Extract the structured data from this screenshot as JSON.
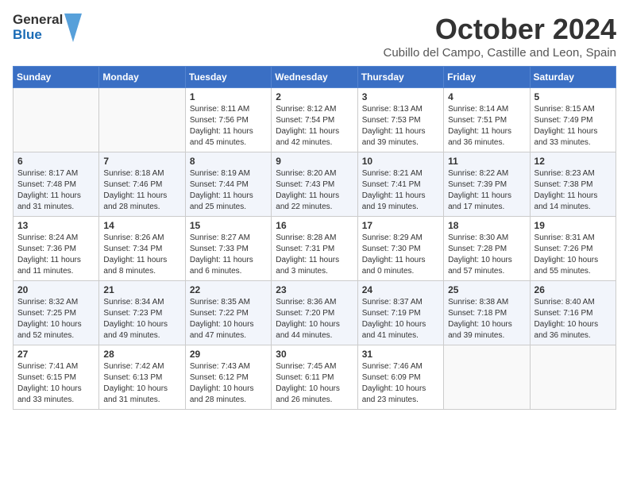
{
  "logo": {
    "line1": "General",
    "line2": "Blue"
  },
  "header": {
    "month": "October 2024",
    "location": "Cubillo del Campo, Castille and Leon, Spain"
  },
  "weekdays": [
    "Sunday",
    "Monday",
    "Tuesday",
    "Wednesday",
    "Thursday",
    "Friday",
    "Saturday"
  ],
  "weeks": [
    [
      {
        "day": "",
        "info": ""
      },
      {
        "day": "",
        "info": ""
      },
      {
        "day": "1",
        "info": "Sunrise: 8:11 AM\nSunset: 7:56 PM\nDaylight: 11 hours and 45 minutes."
      },
      {
        "day": "2",
        "info": "Sunrise: 8:12 AM\nSunset: 7:54 PM\nDaylight: 11 hours and 42 minutes."
      },
      {
        "day": "3",
        "info": "Sunrise: 8:13 AM\nSunset: 7:53 PM\nDaylight: 11 hours and 39 minutes."
      },
      {
        "day": "4",
        "info": "Sunrise: 8:14 AM\nSunset: 7:51 PM\nDaylight: 11 hours and 36 minutes."
      },
      {
        "day": "5",
        "info": "Sunrise: 8:15 AM\nSunset: 7:49 PM\nDaylight: 11 hours and 33 minutes."
      }
    ],
    [
      {
        "day": "6",
        "info": "Sunrise: 8:17 AM\nSunset: 7:48 PM\nDaylight: 11 hours and 31 minutes."
      },
      {
        "day": "7",
        "info": "Sunrise: 8:18 AM\nSunset: 7:46 PM\nDaylight: 11 hours and 28 minutes."
      },
      {
        "day": "8",
        "info": "Sunrise: 8:19 AM\nSunset: 7:44 PM\nDaylight: 11 hours and 25 minutes."
      },
      {
        "day": "9",
        "info": "Sunrise: 8:20 AM\nSunset: 7:43 PM\nDaylight: 11 hours and 22 minutes."
      },
      {
        "day": "10",
        "info": "Sunrise: 8:21 AM\nSunset: 7:41 PM\nDaylight: 11 hours and 19 minutes."
      },
      {
        "day": "11",
        "info": "Sunrise: 8:22 AM\nSunset: 7:39 PM\nDaylight: 11 hours and 17 minutes."
      },
      {
        "day": "12",
        "info": "Sunrise: 8:23 AM\nSunset: 7:38 PM\nDaylight: 11 hours and 14 minutes."
      }
    ],
    [
      {
        "day": "13",
        "info": "Sunrise: 8:24 AM\nSunset: 7:36 PM\nDaylight: 11 hours and 11 minutes."
      },
      {
        "day": "14",
        "info": "Sunrise: 8:26 AM\nSunset: 7:34 PM\nDaylight: 11 hours and 8 minutes."
      },
      {
        "day": "15",
        "info": "Sunrise: 8:27 AM\nSunset: 7:33 PM\nDaylight: 11 hours and 6 minutes."
      },
      {
        "day": "16",
        "info": "Sunrise: 8:28 AM\nSunset: 7:31 PM\nDaylight: 11 hours and 3 minutes."
      },
      {
        "day": "17",
        "info": "Sunrise: 8:29 AM\nSunset: 7:30 PM\nDaylight: 11 hours and 0 minutes."
      },
      {
        "day": "18",
        "info": "Sunrise: 8:30 AM\nSunset: 7:28 PM\nDaylight: 10 hours and 57 minutes."
      },
      {
        "day": "19",
        "info": "Sunrise: 8:31 AM\nSunset: 7:26 PM\nDaylight: 10 hours and 55 minutes."
      }
    ],
    [
      {
        "day": "20",
        "info": "Sunrise: 8:32 AM\nSunset: 7:25 PM\nDaylight: 10 hours and 52 minutes."
      },
      {
        "day": "21",
        "info": "Sunrise: 8:34 AM\nSunset: 7:23 PM\nDaylight: 10 hours and 49 minutes."
      },
      {
        "day": "22",
        "info": "Sunrise: 8:35 AM\nSunset: 7:22 PM\nDaylight: 10 hours and 47 minutes."
      },
      {
        "day": "23",
        "info": "Sunrise: 8:36 AM\nSunset: 7:20 PM\nDaylight: 10 hours and 44 minutes."
      },
      {
        "day": "24",
        "info": "Sunrise: 8:37 AM\nSunset: 7:19 PM\nDaylight: 10 hours and 41 minutes."
      },
      {
        "day": "25",
        "info": "Sunrise: 8:38 AM\nSunset: 7:18 PM\nDaylight: 10 hours and 39 minutes."
      },
      {
        "day": "26",
        "info": "Sunrise: 8:40 AM\nSunset: 7:16 PM\nDaylight: 10 hours and 36 minutes."
      }
    ],
    [
      {
        "day": "27",
        "info": "Sunrise: 7:41 AM\nSunset: 6:15 PM\nDaylight: 10 hours and 33 minutes."
      },
      {
        "day": "28",
        "info": "Sunrise: 7:42 AM\nSunset: 6:13 PM\nDaylight: 10 hours and 31 minutes."
      },
      {
        "day": "29",
        "info": "Sunrise: 7:43 AM\nSunset: 6:12 PM\nDaylight: 10 hours and 28 minutes."
      },
      {
        "day": "30",
        "info": "Sunrise: 7:45 AM\nSunset: 6:11 PM\nDaylight: 10 hours and 26 minutes."
      },
      {
        "day": "31",
        "info": "Sunrise: 7:46 AM\nSunset: 6:09 PM\nDaylight: 10 hours and 23 minutes."
      },
      {
        "day": "",
        "info": ""
      },
      {
        "day": "",
        "info": ""
      }
    ]
  ]
}
